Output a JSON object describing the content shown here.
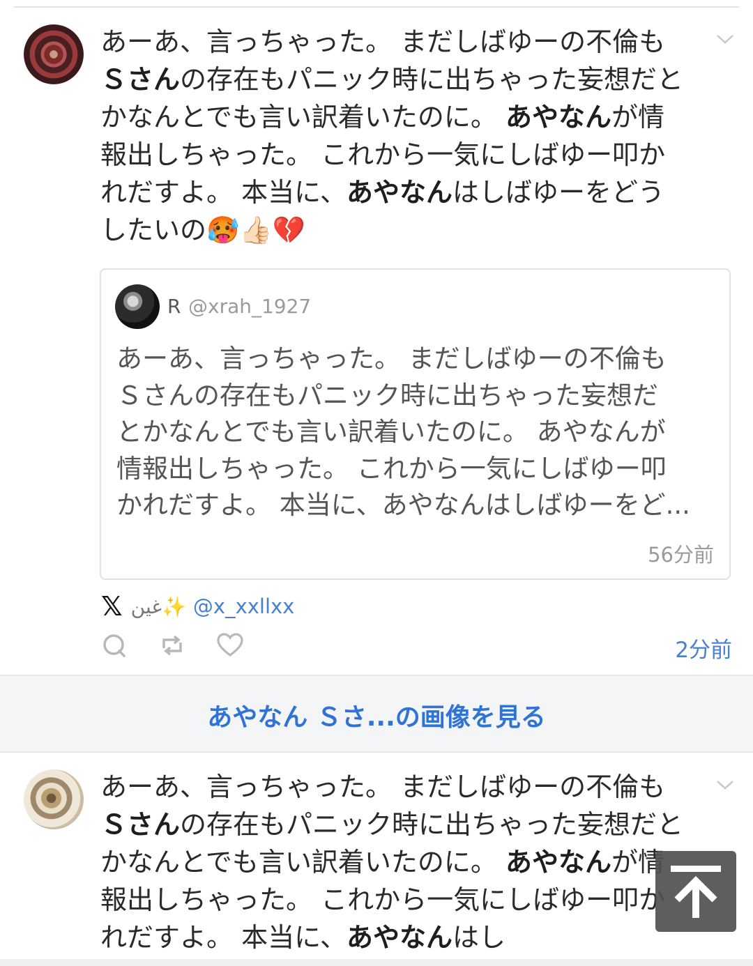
{
  "post1": {
    "text_segments": [
      {
        "t": "あーあ、言っちゃった。 まだしばゆーの不倫も",
        "b": false
      },
      {
        "t": "\n",
        "b": false
      },
      {
        "t": "Ｓさん",
        "b": true
      },
      {
        "t": "の存在もパニック時に出ちゃった妄想だと",
        "b": false
      },
      {
        "t": "\n",
        "b": false
      },
      {
        "t": "かなんとでも言い訳着いたのに。 ",
        "b": false
      },
      {
        "t": "あやなん",
        "b": true
      },
      {
        "t": "が情",
        "b": false
      },
      {
        "t": "\n",
        "b": false
      },
      {
        "t": "報出しちゃった。 これから一気にしばゆー叩か",
        "b": false
      },
      {
        "t": "\n",
        "b": false
      },
      {
        "t": "れだすよ。 本当に、",
        "b": false
      },
      {
        "t": "あやなん",
        "b": true
      },
      {
        "t": "はしばゆーをどう",
        "b": false
      },
      {
        "t": "\n",
        "b": false
      },
      {
        "t": "したいの🥵👍🏻💔",
        "b": false
      }
    ],
    "quote": {
      "name": "R",
      "handle": "@xrah_1927",
      "text_lines": [
        "あーあ、言っちゃった。 まだしばゆーの不倫も",
        "Ｓさんの存在もパニック時に出ちゃった妄想だ",
        "とかなんとでも言い訳着いたのに。 あやなんが",
        "情報出しちゃった。 これから一気にしばゆー叩",
        "かれだすよ。 本当に、あやなんはしばゆーをど..."
      ],
      "time": "56分前"
    },
    "source": {
      "platform_icon": "x-logo-icon",
      "name": "غين✨",
      "handle": "@x_xxllxx"
    },
    "time": "2分前"
  },
  "image_band": {
    "label": "あやなん Ｓさ...の画像を見る"
  },
  "post2": {
    "text_segments": [
      {
        "t": "あーあ、言っちゃった。 まだしばゆーの不倫も",
        "b": false
      },
      {
        "t": "\n",
        "b": false
      },
      {
        "t": "Ｓさん",
        "b": true
      },
      {
        "t": "の存在もパニック時に出ちゃった妄想だと",
        "b": false
      },
      {
        "t": "\n",
        "b": false
      },
      {
        "t": "かなんとでも言い訳着いたのに。 ",
        "b": false
      },
      {
        "t": "あやなん",
        "b": true
      },
      {
        "t": "が情",
        "b": false
      },
      {
        "t": "\n",
        "b": false
      },
      {
        "t": "報出しちゃった。 これから一気にしばゆー叩か",
        "b": false
      },
      {
        "t": "\n",
        "b": false
      },
      {
        "t": "れだすよ。 本当に、",
        "b": false
      },
      {
        "t": "あやなん",
        "b": true
      },
      {
        "t": "はし",
        "b": false
      }
    ]
  },
  "colors": {
    "link": "#2f73d6",
    "handle": "#4a7fd0",
    "muted": "#9a9a9a",
    "band_bg": "#f4f5f6"
  },
  "icons": {
    "reply": "reply-icon",
    "retweet": "retweet-icon",
    "like": "heart-icon",
    "menu": "chevron-down-icon",
    "scroll_top": "arrow-up-icon"
  }
}
